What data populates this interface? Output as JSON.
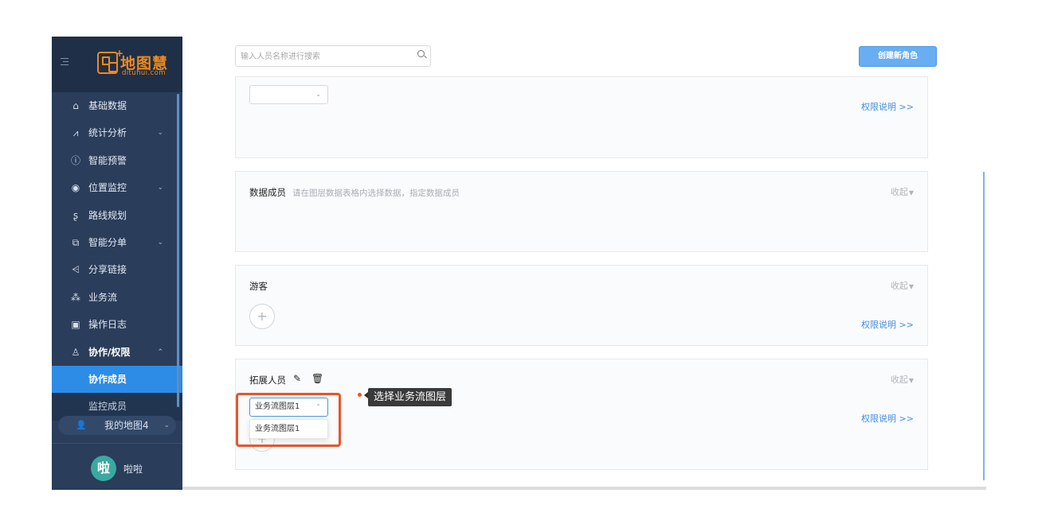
{
  "app": {
    "logo_cn": "地图慧",
    "logo_en": "dituhui.com"
  },
  "sidebar": {
    "items": [
      {
        "label": "基础数据",
        "icon": "home-icon",
        "glyph": "⌂",
        "has_caret": false
      },
      {
        "label": "统计分析",
        "icon": "chart-line-icon",
        "glyph": "⩘",
        "has_caret": true
      },
      {
        "label": "智能预警",
        "icon": "info-icon",
        "glyph": "ⓘ",
        "has_caret": false
      },
      {
        "label": "位置监控",
        "icon": "location-pin-icon",
        "glyph": "◉",
        "has_caret": true
      },
      {
        "label": "路线规划",
        "icon": "route-icon",
        "glyph": "ʂ",
        "has_caret": false
      },
      {
        "label": "智能分单",
        "icon": "copy-icon",
        "glyph": "⧉",
        "has_caret": true
      },
      {
        "label": "分享链接",
        "icon": "share-icon",
        "glyph": "⩤",
        "has_caret": false
      },
      {
        "label": "业务流",
        "icon": "workflow-icon",
        "glyph": "⁂",
        "has_caret": false
      },
      {
        "label": "操作日志",
        "icon": "calendar-icon",
        "glyph": "▣",
        "has_caret": false
      },
      {
        "label": "协作/权限",
        "icon": "user-icon",
        "glyph": "♙",
        "has_caret": true
      }
    ],
    "sub_items": [
      {
        "label": "协作成员",
        "active": true
      },
      {
        "label": "监控成员",
        "active": false
      }
    ],
    "my_map": "我的地图4",
    "user": {
      "avatar_char": "啦",
      "name": "啦啦"
    }
  },
  "search": {
    "placeholder": "输入人员名称进行搜索"
  },
  "toolbar": {
    "create_role": "创建新角色"
  },
  "cards": {
    "first": {
      "permission_link": "权限说明 >>"
    },
    "data_members": {
      "title": "数据成员",
      "desc": "请在图层数据表格内选择数据，指定数据成员",
      "collapse": "收起"
    },
    "guest": {
      "title": "游客",
      "collapse": "收起",
      "permission_link": "权限说明 >>",
      "add": "+"
    },
    "expand": {
      "title": "拓展人员",
      "collapse": "收起",
      "permission_link": "权限说明 >>",
      "select_value": "业务流图层1",
      "add": "+"
    }
  },
  "dropdown": {
    "options": [
      "业务流图层1"
    ]
  },
  "annotation": {
    "text": "选择业务流图层",
    "color": "#e8552a"
  },
  "colors": {
    "sidebar": "#2a3d5a",
    "accent": "#2d8ce6",
    "link": "#3f8fe0",
    "logo": "#f08a1c"
  }
}
